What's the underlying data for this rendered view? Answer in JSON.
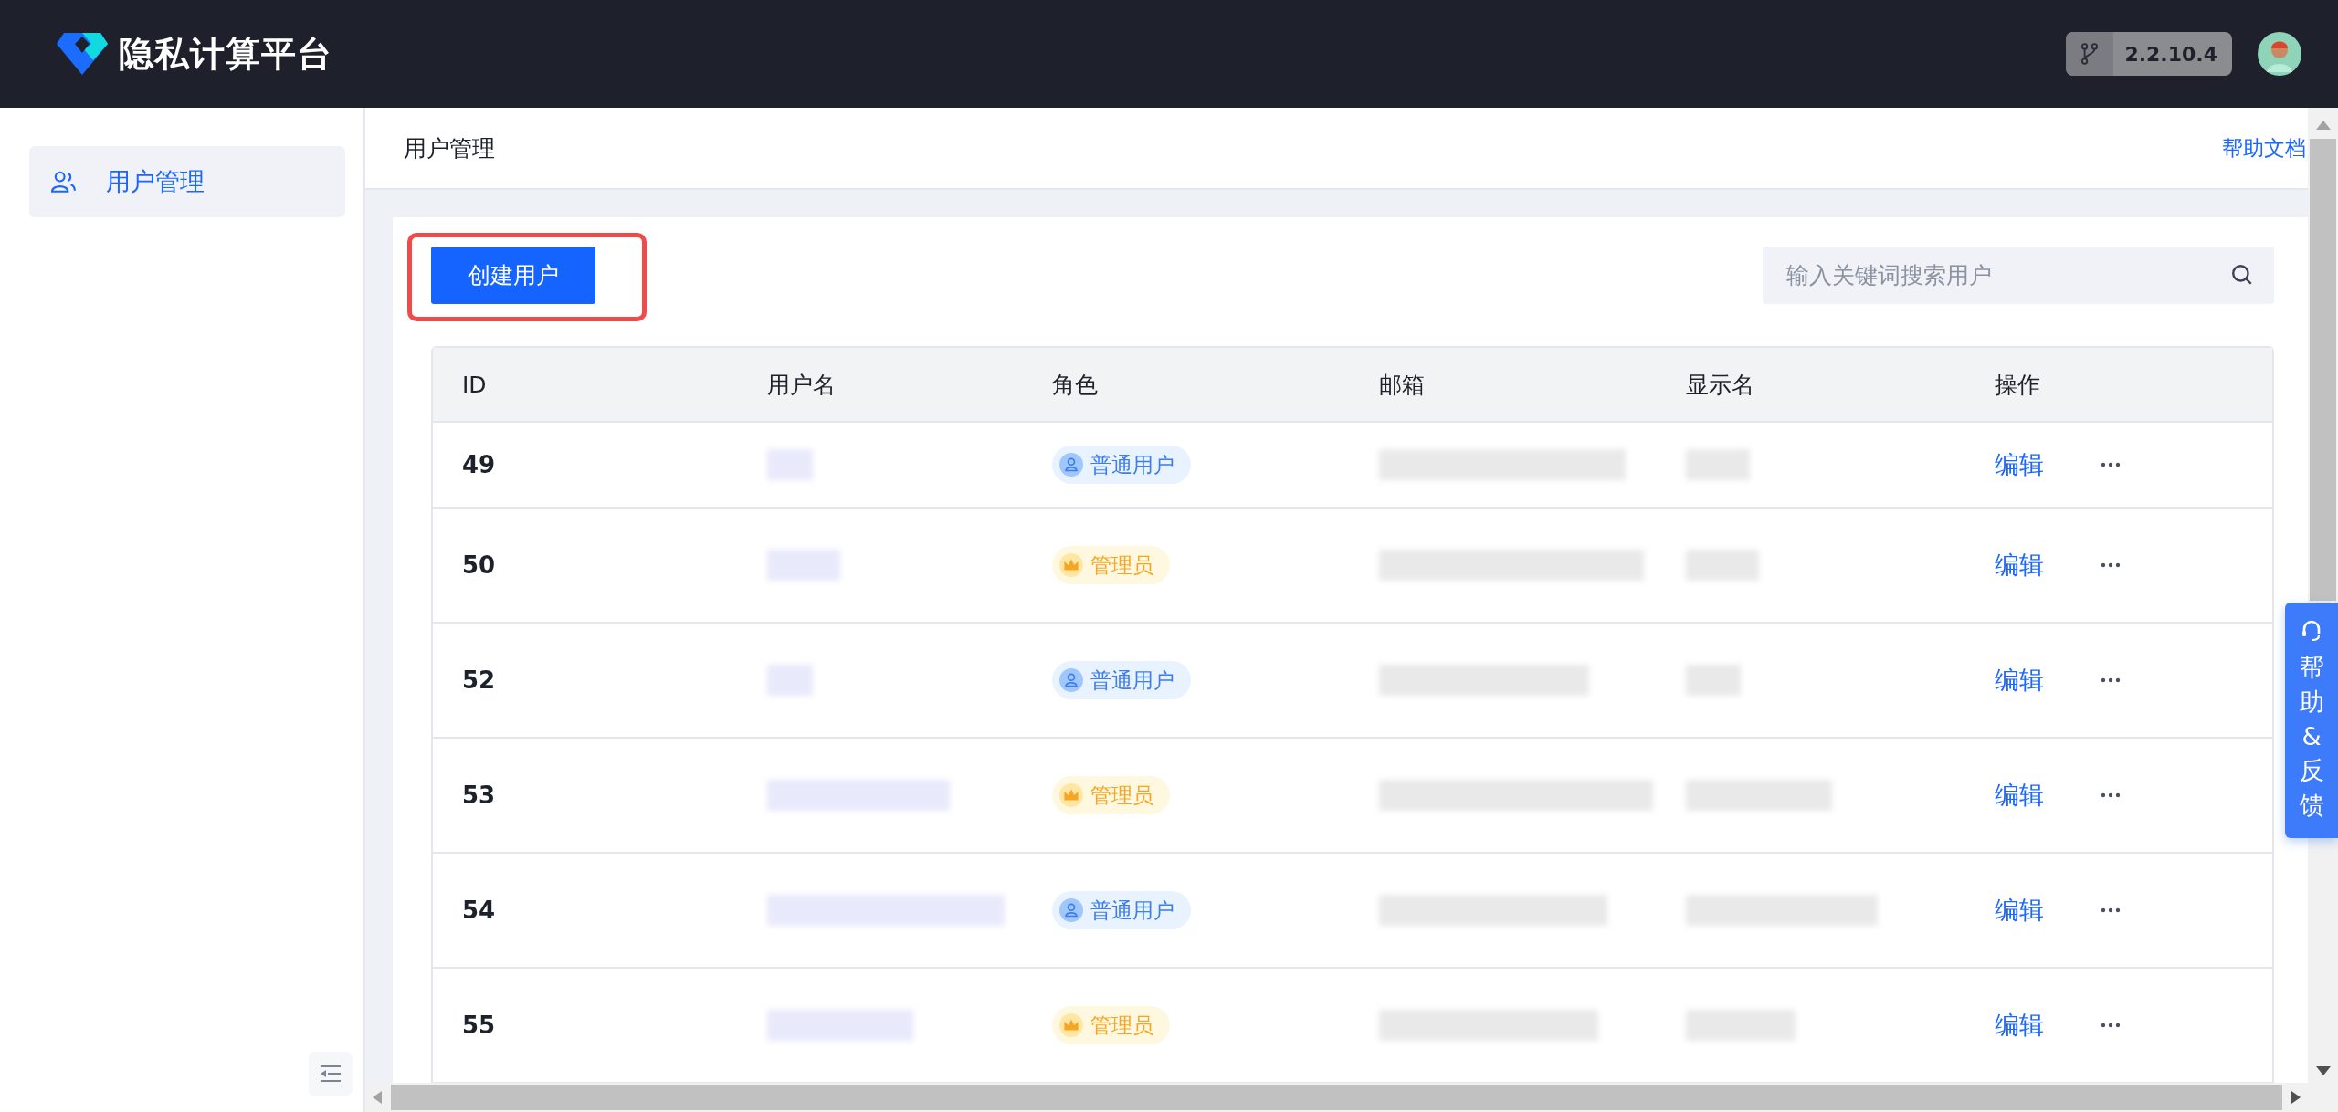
{
  "header": {
    "title": "隐私计算平台",
    "version": "2.2.10.4"
  },
  "sidebar": {
    "items": [
      {
        "label": "用户管理",
        "selected": true
      }
    ]
  },
  "breadcrumb": {
    "title": "用户管理",
    "help_link": "帮助文档"
  },
  "toolbar": {
    "create_button": "创建用户",
    "search": {
      "placeholder": "输入关键词搜索用户"
    }
  },
  "table": {
    "columns": [
      "ID",
      "用户名",
      "角色",
      "邮箱",
      "显示名",
      "操作"
    ],
    "rows": [
      {
        "id": "49",
        "role": {
          "kind": "user",
          "label": "普通用户"
        },
        "action": "编辑"
      },
      {
        "id": "50",
        "role": {
          "kind": "admin",
          "label": "管理员"
        },
        "action": "编辑"
      },
      {
        "id": "52",
        "role": {
          "kind": "user",
          "label": "普通用户"
        },
        "action": "编辑"
      },
      {
        "id": "53",
        "role": {
          "kind": "admin",
          "label": "管理员"
        },
        "action": "编辑"
      },
      {
        "id": "54",
        "role": {
          "kind": "user",
          "label": "普通用户"
        },
        "action": "编辑"
      },
      {
        "id": "55",
        "role": {
          "kind": "admin",
          "label": "管理员"
        },
        "action": "编辑"
      }
    ]
  },
  "help_widget": {
    "label": "帮助&反馈"
  }
}
